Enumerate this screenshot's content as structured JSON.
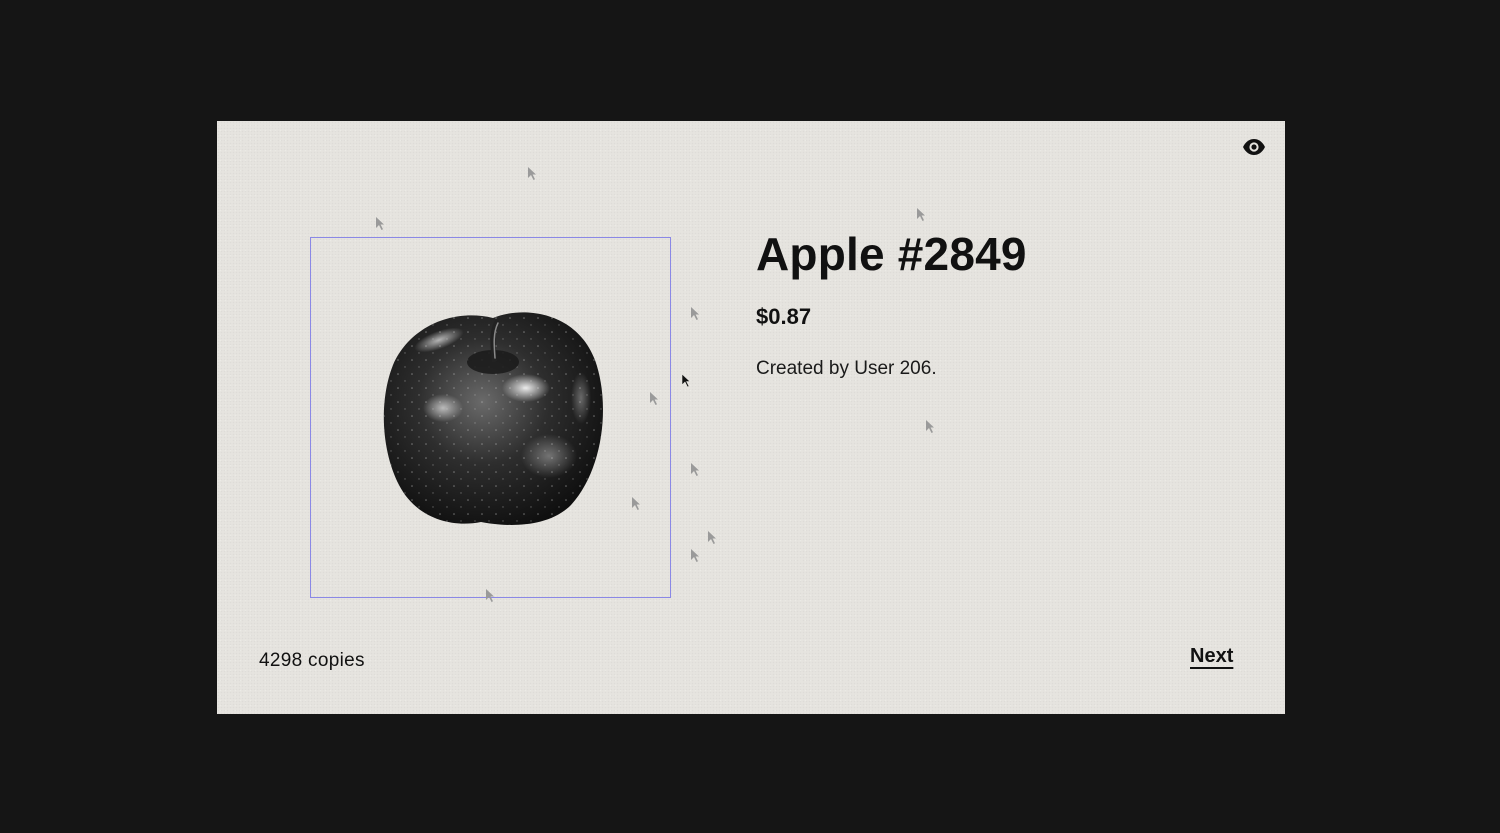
{
  "header": {
    "visibility_icon": "eye-icon"
  },
  "product": {
    "title": "Apple #2849",
    "price": "$0.87",
    "creator": "Created by User 206.",
    "image_icon": "apple-image"
  },
  "footer": {
    "copies": "4298 copies",
    "next_label": "Next"
  },
  "colors": {
    "page_background": "#151515",
    "card_background": "#e6e4df",
    "frame_border": "#8a88e6",
    "text": "#111111",
    "ghost_cursor": "#9a9a9a",
    "active_cursor": "#111111"
  }
}
